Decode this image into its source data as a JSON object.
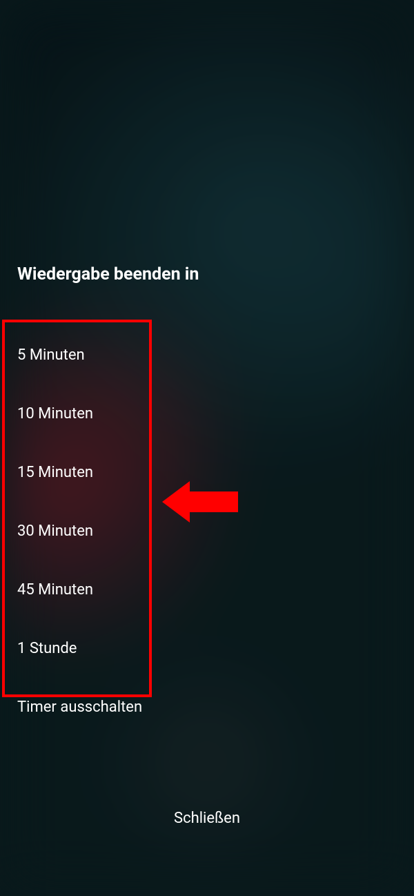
{
  "title": "Wiedergabe beenden in",
  "options": [
    {
      "label": "5 Minuten"
    },
    {
      "label": "10 Minuten"
    },
    {
      "label": "15 Minuten"
    },
    {
      "label": "30 Minuten"
    },
    {
      "label": "45 Minuten"
    },
    {
      "label": "1 Stunde"
    },
    {
      "label": "Timer ausschalten"
    }
  ],
  "close_label": "Schließen",
  "annotation": {
    "highlight_color": "#ff0000",
    "arrow_color": "#ff0000"
  }
}
